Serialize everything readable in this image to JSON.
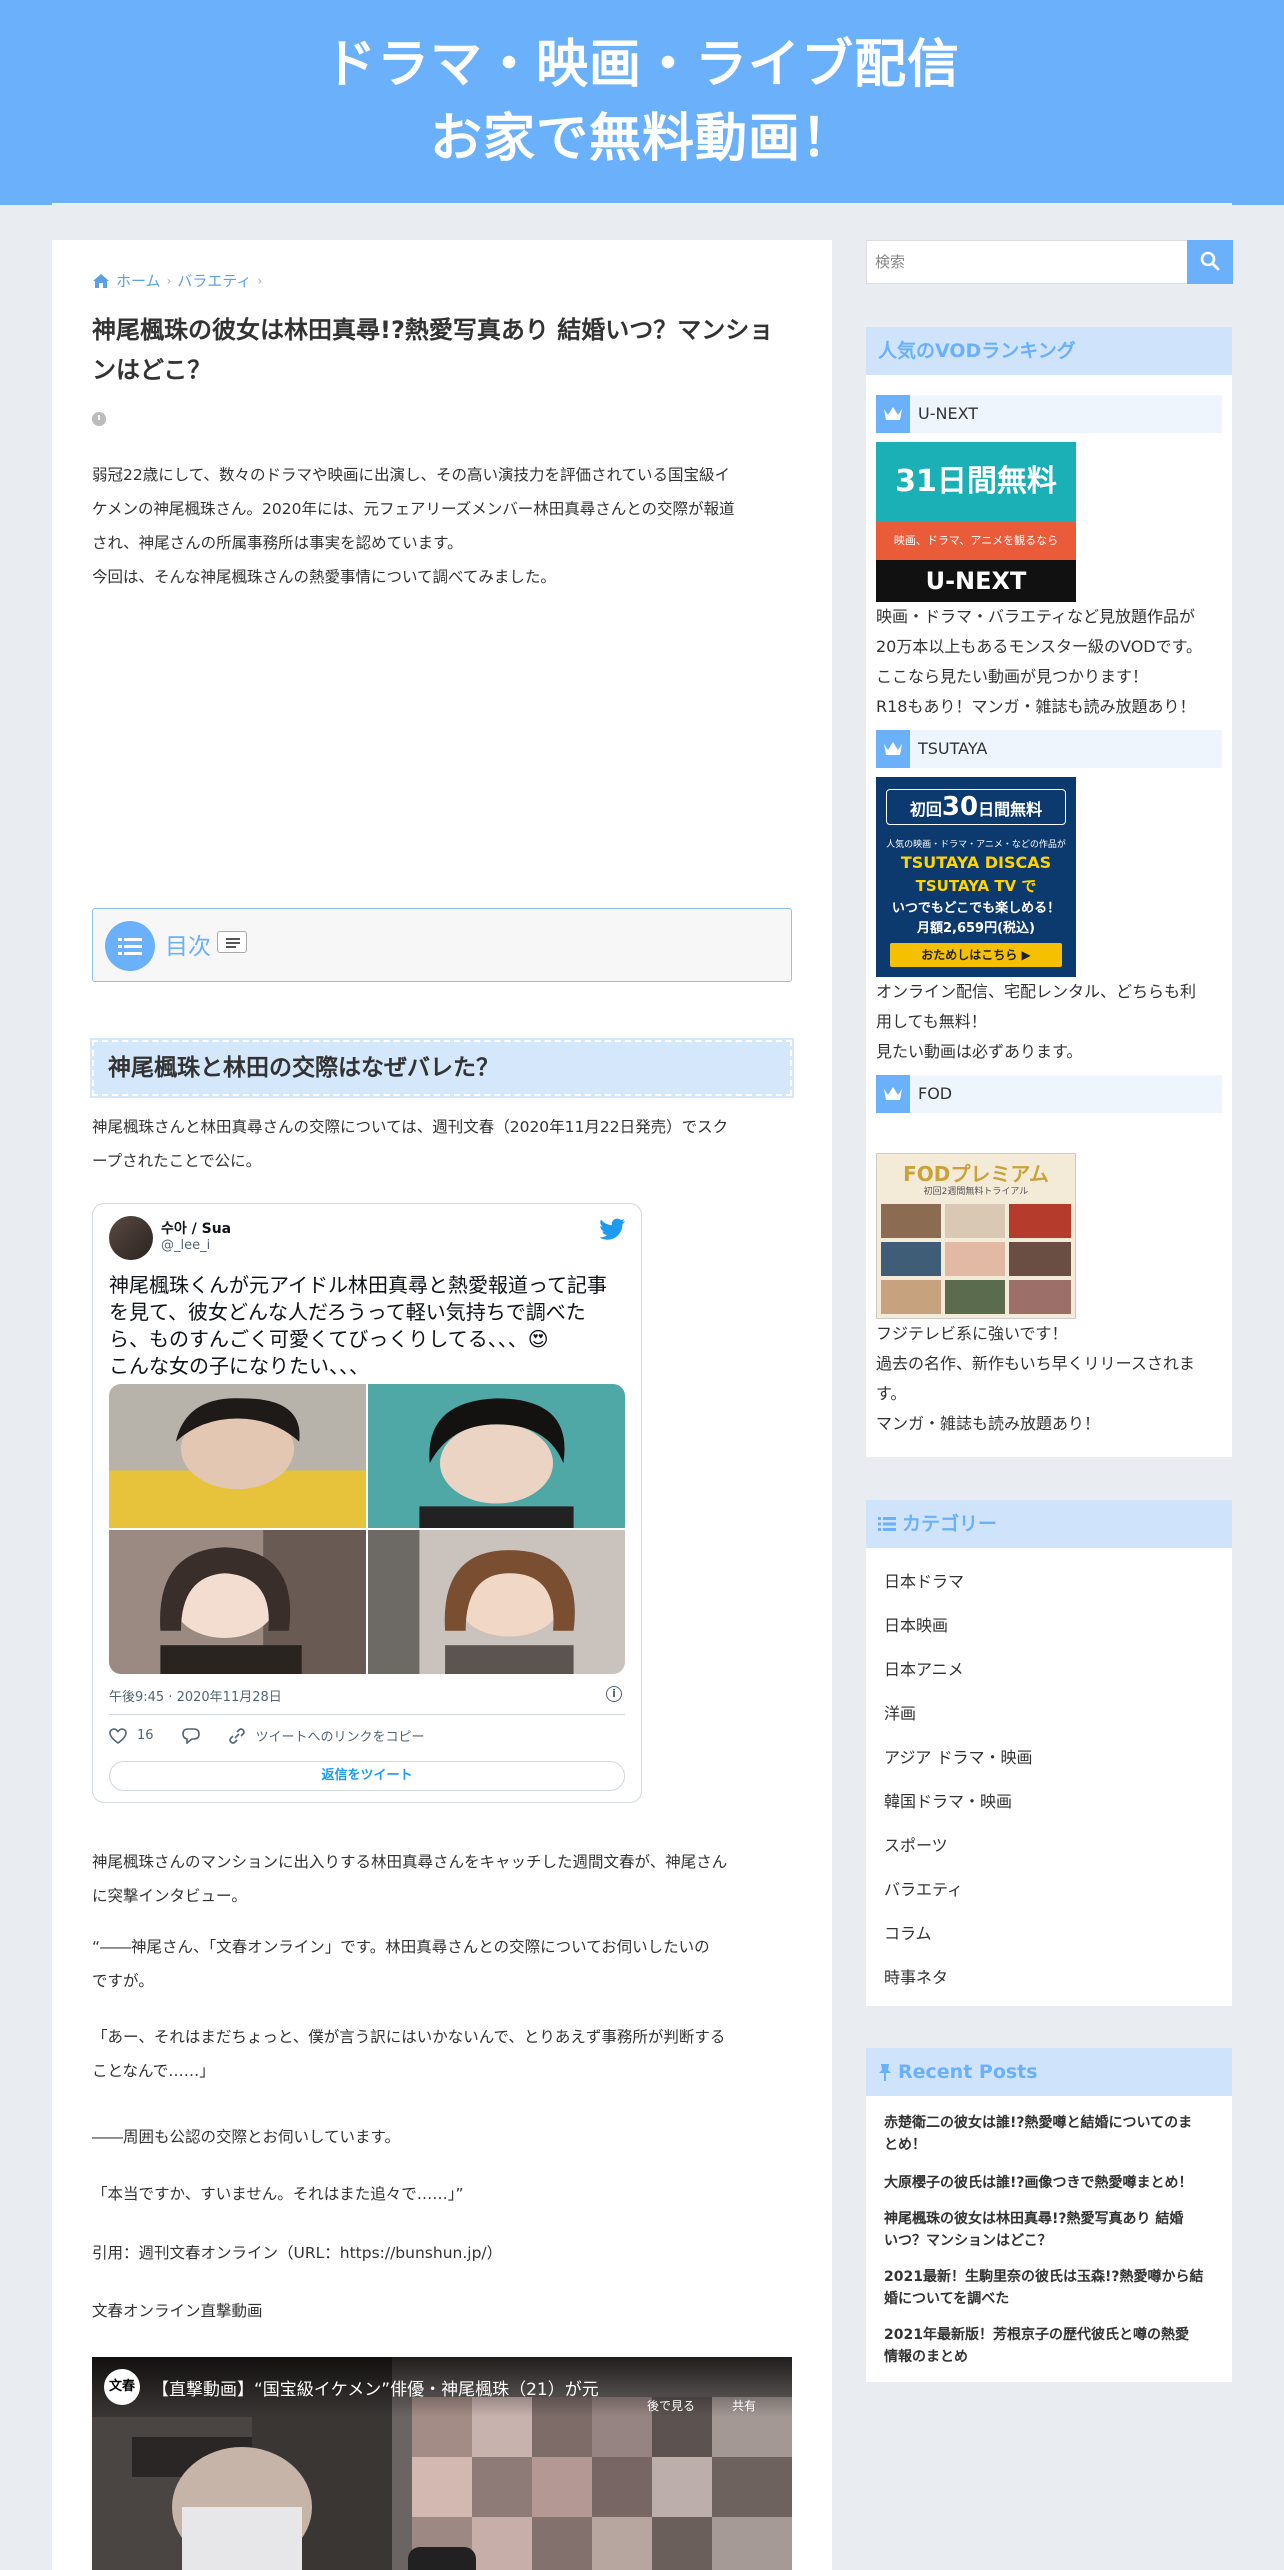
{
  "header": {
    "title_line1": "ドラマ・映画・ライブ配信",
    "title_line2": "お家で無料動画！",
    "bg_color": "#6ab0fa"
  },
  "breadcrumb": {
    "home": "ホーム",
    "category": "バラエティ"
  },
  "article": {
    "title": "神尾楓珠の彼女は林田真尋!?熱愛写真あり 結婚いつ？マンションはどこ？",
    "intro": [
      "弱冠22歳にして、数々のドラマや映画に出演し、その高い演技力を評価されている国宝級イ",
      "ケメンの神尾楓珠さん。2020年には、元フェアリーズメンバー林田真尋さんとの交際が報道",
      "され、神尾さんの所属事務所は事実を認めています。",
      "今回は、そんな神尾楓珠さんの熱愛事情について調べてみました。"
    ],
    "toc_label": "目次",
    "h2": "神尾楓珠と林田の交際はなぜバレた？",
    "p1": [
      "神尾楓珠さんと林田真尋さんの交際については、週刊文春（2020年11月22日発売）でスク",
      "ープされたことで公に。"
    ],
    "p2": [
      "神尾楓珠さんのマンションに出入りする林田真尋さんをキャッチした週間文春が、神尾さん",
      "に突撃インタビュー。"
    ],
    "p3": [
      "“――神尾さん、「文春オンライン」です。林田真尋さんとの交際についてお伺いしたいの",
      "ですが。"
    ],
    "p4": [
      "「あー、それはまだちょっと、僕が言う訳にはいかないんで、とりあえず事務所が判断する",
      "ことなんで……」"
    ],
    "p5": "――周囲も公認の交際とお伺いしています。",
    "p6": "「本当ですか、すいません。それはまた追々で……」”",
    "p7": "引用：週刊文春オンライン（URL：https://bunshun.jp/）",
    "p8": "文春オンライン直撃動画"
  },
  "tweet": {
    "name": "수아 / Sua",
    "handle": "@_lee_i",
    "text": [
      "神尾楓珠くんが元アイドル林田真尋と熱愛報道って記事",
      "を見て、彼女どんな人だろうって軽い気持ちで調べた",
      "ら、ものすんごく可愛くてびっくりしてる、、、😍",
      "こんな女の子になりたい、、、"
    ],
    "time": "午後9:45 · 2020年11月28日",
    "likes": "16",
    "copy_link": "ツイートへのリンクをコピー",
    "reply": "返信をツイート"
  },
  "video": {
    "logo": "文春",
    "title": "【直撃動画】“国宝級イケメン”俳優・神尾楓珠（21）が元",
    "watch_later": "後で見る",
    "share": "共有"
  },
  "sidebar": {
    "search_placeholder": "検索",
    "ranking_title": "人気のVODランキング",
    "unext": {
      "name": "U-NEXT",
      "banner_main": "31日間無料",
      "banner_sub": "映画、ドラマ、アニメを観るなら",
      "banner_brand": "U-NEXT",
      "desc": [
        "映画・ドラマ・バラエティなど見放題作品が",
        "20万本以上もあるモンスター級のVODです。",
        "ここなら見たい動画が見つかります！",
        "R18もあり！マンガ・雑誌も読み放題あり！"
      ]
    },
    "tsutaya": {
      "name": "TSUTAYA",
      "banner_l1a": "初回",
      "banner_l1b": "30",
      "banner_l1c": "日間無料",
      "banner_l2": "人気の映画・ドラマ・アニメ・などの作品が",
      "banner_l3": "TSUTAYA DISCAS",
      "banner_l4": "TSUTAYA TV で",
      "banner_l5": "いつでもどこでも楽しめる！",
      "banner_l6": "月額2,659円(税込)",
      "banner_btn": "おためしはこちら ▶",
      "desc": [
        "オンライン配信、宅配レンタル、どちらも利",
        "用しても無料！",
        "見たい動画は必ずあります。"
      ]
    },
    "fod": {
      "name": "FOD",
      "banner_title": "FODプレミアム",
      "banner_sub": "初回2週間無料トライアル",
      "desc": [
        "フジテレビ系に強いです！",
        "過去の名作、新作もいち早くリリースされま",
        "す。",
        "マンガ・雑誌も読み放題あり！"
      ]
    },
    "category_title": "カテゴリー",
    "categories": [
      "日本ドラマ",
      "日本映画",
      "日本アニメ",
      "洋画",
      "アジア ドラマ・映画",
      "韓国ドラマ・映画",
      "スポーツ",
      "バラエティ",
      "コラム",
      "時事ネタ"
    ],
    "recent_title": "Recent Posts",
    "recent": [
      [
        "赤楚衛二の彼女は誰!?熱愛噂と結婚についてのま",
        "とめ！"
      ],
      [
        "大原櫻子の彼氏は誰!?画像つきで熱愛噂まとめ！"
      ],
      [
        "神尾楓珠の彼女は林田真尋!?熱愛写真あり 結婚",
        "いつ？マンションはどこ？"
      ],
      [
        "2021最新！生駒里奈の彼氏は玉森!?熱愛噂から結",
        "婚についてを調べた"
      ],
      [
        "2021年最新版！芳根京子の歴代彼氏と噂の熱愛",
        "情報のまとめ"
      ]
    ]
  }
}
